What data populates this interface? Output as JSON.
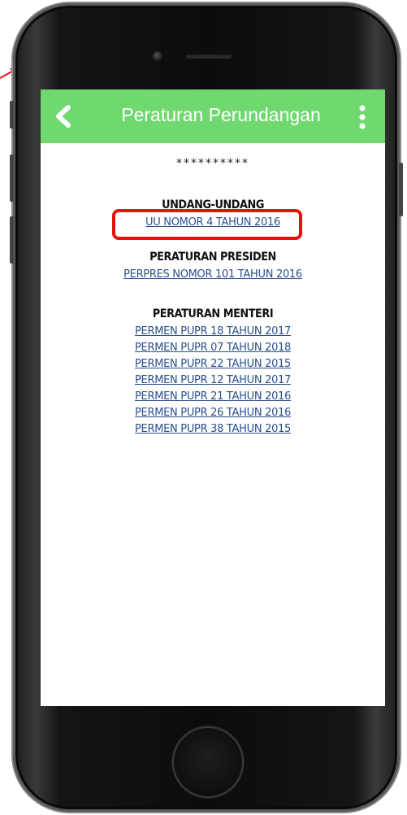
{
  "appbar": {
    "title": "Peraturan Perundangan",
    "back_icon": "chevron-left-icon",
    "menu_icon": "more-vertical-icon",
    "color": "#6fd86f"
  },
  "content": {
    "separator": "**********",
    "sections": [
      {
        "title": "UNDANG-UNDANG",
        "links": [
          "UU NOMOR 4 TAHUN 2016"
        ]
      },
      {
        "title": "PERATURAN PRESIDEN",
        "links": [
          "PERPRES NOMOR 101 TAHUN 2016"
        ]
      },
      {
        "title": "PERATURAN MENTERI",
        "links": [
          "PERMEN PUPR 18 TAHUN 2017",
          "PERMEN PUPR 07 TAHUN 2018",
          "PERMEN PUPR 22 TAHUN 2015",
          "PERMEN PUPR 12 TAHUN 2017",
          "PERMEN PUPR 21 TAHUN 2016",
          "PERMEN PUPR 26 TAHUN 2016",
          "PERMEN PUPR 38 TAHUN 2015"
        ]
      }
    ]
  },
  "annotation": {
    "highlight_color": "#e81010",
    "highlighted_item": "UU NOMOR 4 TAHUN 2016"
  }
}
